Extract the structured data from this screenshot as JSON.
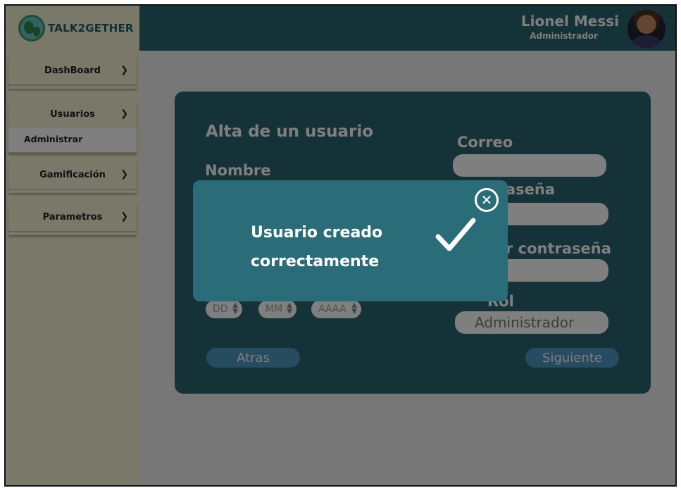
{
  "app": {
    "logo_text": "TALK2GETHER"
  },
  "user": {
    "name": "Lionel Messi",
    "role": "Administrador"
  },
  "sidebar": {
    "items": [
      {
        "label": "DashBoard"
      },
      {
        "label": "Usuarios",
        "sub_items": [
          {
            "label": "Administrar"
          }
        ]
      },
      {
        "label": "Gamificación"
      },
      {
        "label": "Parametros"
      }
    ]
  },
  "form": {
    "title": "Alta de un usuario",
    "nombre_label": "Nombre",
    "correo_label": "Correo",
    "contrasena_label_visible": "aseña",
    "confirmar_label_visible": "r contraseña",
    "rol_label": "Rol",
    "rol_value": "Administrador",
    "date_day_placeholder": "DD",
    "date_month_placeholder": "MM",
    "date_year_placeholder": "AAAA",
    "back_button": "Atras",
    "next_button": "Siguiente"
  },
  "modal": {
    "message_line1": "Usuario creado",
    "message_line2": "correctamente",
    "close_symbol": "✕"
  },
  "icons": {
    "chevron": "chevron-down-icon",
    "check": "check-icon",
    "close": "close-icon",
    "spinner": "spinner-arrows-icon"
  },
  "colors": {
    "primary": "#2b6470",
    "sidebar": "#f5f3d2",
    "button": "#4c98c4",
    "modal": "#2a6d79"
  }
}
